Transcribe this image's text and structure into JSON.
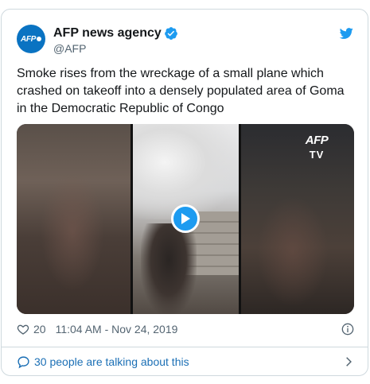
{
  "account": {
    "display_name": "AFP news agency",
    "handle": "@AFP",
    "avatar_text": "AFP"
  },
  "tweet": {
    "text": "Smoke rises from the wreckage of a small plane which crashed on takeoff into a densely populated area of Goma in the Democratic Republic of Congo"
  },
  "media": {
    "overlay_logo": "AFP",
    "overlay_sub": "TV",
    "play_icon": "play-icon"
  },
  "meta": {
    "like_count": "20",
    "timestamp": "11:04 AM - Nov 24, 2019"
  },
  "footer": {
    "conversation_text": "30 people are talking about this"
  },
  "colors": {
    "accent": "#1d9bf0",
    "link": "#1b6fb5",
    "muted": "#536471",
    "border": "#cfd9de",
    "avatar_bg": "#0a73c2"
  },
  "icons": [
    "verified-badge-icon",
    "twitter-bird-icon",
    "play-icon",
    "heart-icon",
    "info-icon",
    "comment-bubble-icon",
    "chevron-right-icon"
  ]
}
